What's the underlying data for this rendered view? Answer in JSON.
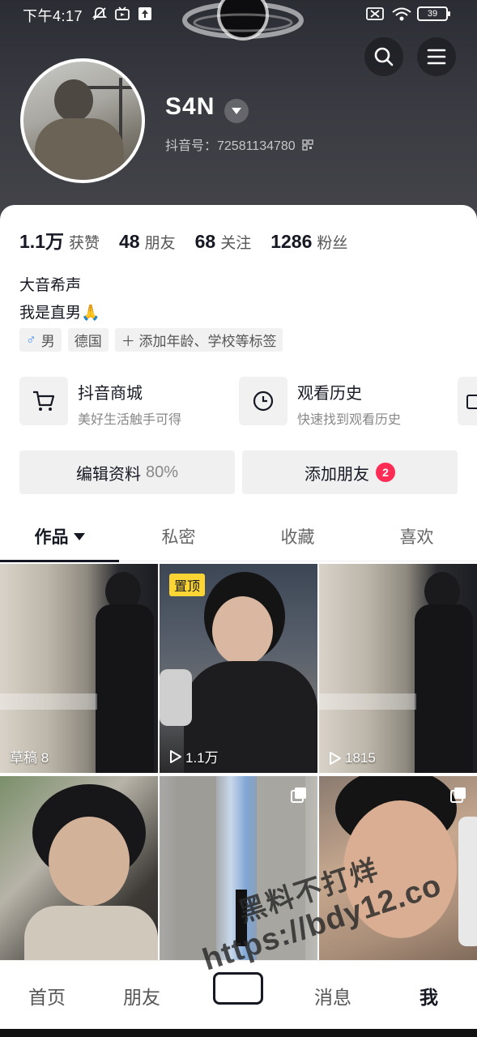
{
  "status_bar": {
    "time": "下午4:17",
    "battery": "39",
    "icons": [
      "mute-icon",
      "tv-icon",
      "upload-icon",
      "sim-icon",
      "wifi-icon",
      "battery-icon"
    ]
  },
  "header": {
    "search_icon": "search-icon",
    "menu_icon": "menu-icon"
  },
  "profile": {
    "username": "S4N",
    "douyin_id": "抖音号：72581134780",
    "stats": [
      {
        "num": "1.1万",
        "label": "获赞"
      },
      {
        "num": "48",
        "label": "朋友"
      },
      {
        "num": "68",
        "label": "关注"
      },
      {
        "num": "1286",
        "label": "粉丝"
      }
    ],
    "bio_line1": "大音希声",
    "bio_line2": "我是直男🙏",
    "tags": {
      "gender": "男",
      "country": "德国",
      "add": "＋ 添加年龄、学校等标签"
    }
  },
  "services": [
    {
      "title": "抖音商城",
      "subtitle": "美好生活触手可得",
      "icon": "cart-icon"
    },
    {
      "title": "观看历史",
      "subtitle": "快速找到观看历史",
      "icon": "clock-icon"
    }
  ],
  "actions": {
    "edit_label": "编辑资料",
    "edit_pct": "80%",
    "add_friend_label": "添加朋友",
    "add_friend_badge": "2"
  },
  "tabs": [
    "作品",
    "私密",
    "收藏",
    "喜欢"
  ],
  "videos": [
    {
      "label": "草稿 8",
      "kind": "draft"
    },
    {
      "label": "1.1万",
      "kind": "plays",
      "pinned": "置顶"
    },
    {
      "label": "1815",
      "kind": "plays"
    },
    {
      "label": "",
      "kind": "video"
    },
    {
      "label": "",
      "kind": "multi"
    },
    {
      "label": "",
      "kind": "multi"
    }
  ],
  "bottom_nav": [
    "首页",
    "朋友",
    "消息",
    "我"
  ],
  "watermark": {
    "line1": "黑料不打烊",
    "line2": "https://bdy12.co"
  },
  "colors": {
    "accent_red": "#fe2c55",
    "pin_yellow": "#fcd535",
    "gender_blue": "#3d8ff5"
  }
}
